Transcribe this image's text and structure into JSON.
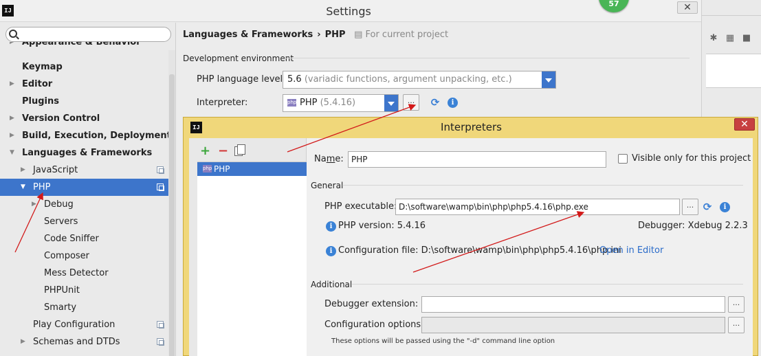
{
  "settings": {
    "title": "Settings",
    "close_label": "✕",
    "badge_count": "57"
  },
  "sidebar": {
    "search_placeholder": "",
    "items": [
      {
        "label": "Appearance & Behavior"
      },
      {
        "label": "Keymap"
      },
      {
        "label": "Editor"
      },
      {
        "label": "Plugins"
      },
      {
        "label": "Version Control"
      },
      {
        "label": "Build, Execution, Deployment"
      },
      {
        "label": "Languages & Frameworks"
      },
      {
        "label": "JavaScript"
      },
      {
        "label": "PHP"
      },
      {
        "label": "Debug"
      },
      {
        "label": "Servers"
      },
      {
        "label": "Code Sniffer"
      },
      {
        "label": "Composer"
      },
      {
        "label": "Mess Detector"
      },
      {
        "label": "PHPUnit"
      },
      {
        "label": "Smarty"
      },
      {
        "label": "Play Configuration"
      },
      {
        "label": "Schemas and DTDs"
      }
    ]
  },
  "main": {
    "breadcrumb_parent": "Languages & Frameworks",
    "breadcrumb_sep": "›",
    "breadcrumb_current": "PHP",
    "for_project": "For current project",
    "section_dev_env": "Development environment",
    "php_level_label": "PHP language level:",
    "php_level_value": "5.6",
    "php_level_desc": "(variadic functions, argument unpacking, etc.)",
    "interpreter_label": "Interpreter:",
    "interpreter_name": "PHP",
    "interpreter_version": "(5.4.16)",
    "dots": "..."
  },
  "interpreters_dialog": {
    "title": "Interpreters",
    "close_label": "✕",
    "list": [
      {
        "label": "PHP"
      }
    ],
    "name_label_pre": "Na",
    "name_label_underlined": "m",
    "name_label_post": "e:",
    "name_value": "PHP",
    "visible_only_label": "Visible only for this project",
    "general_section": "General",
    "executable_label": "PHP executable:",
    "executable_value": "D:\\software\\wamp\\bin\\php\\php5.4.16\\php.exe",
    "php_version_text": "PHP version: 5.4.16",
    "debugger_text": "Debugger: Xdebug 2.2.3",
    "config_file_text": "Configuration file: D:\\software\\wamp\\bin\\php\\php5.4.16\\php.ini",
    "open_in_editor": "Open in Editor",
    "additional_section": "Additional",
    "debugger_ext_label": "Debugger extension:",
    "debugger_ext_value": "",
    "config_options_label": "Configuration options:",
    "config_options_value": "",
    "note": "These options will be passed using the \"-d\" command line option",
    "dots": "..."
  },
  "colors": {
    "selection": "#3d75cb",
    "dialog_border": "#f0d77a",
    "annotation": "#d21a1a"
  }
}
